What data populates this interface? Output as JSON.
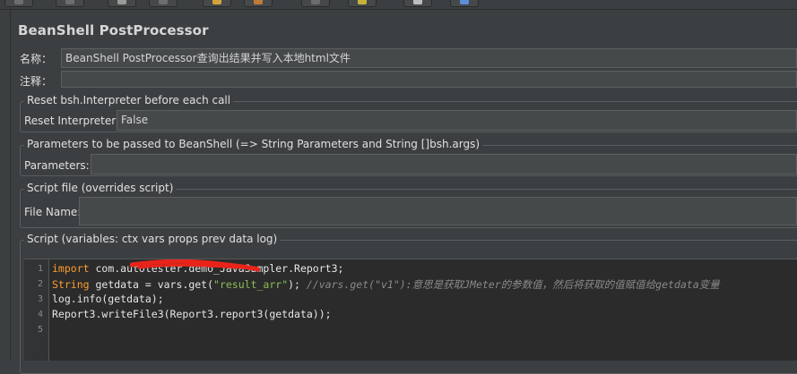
{
  "panel": {
    "title": "BeanShell PostProcessor"
  },
  "name_field": {
    "label": "名称：",
    "value": "BeanShell PostProcessor查询出结果并写入本地html文件"
  },
  "comment_field": {
    "label": "注释：",
    "value": ""
  },
  "reset_group": {
    "title": "Reset bsh.Interpreter before each call",
    "label": "Reset Interpreter:",
    "value": "False"
  },
  "params_group": {
    "title": "Parameters to be passed to BeanShell (=> String Parameters and String []bsh.args)",
    "label": "Parameters:",
    "value": ""
  },
  "script_file_group": {
    "title": "Script file (overrides script)",
    "label": "File Name:",
    "value": ""
  },
  "script_group": {
    "title": "Script (variables: ctx vars props prev data log)",
    "line_numbers": [
      "1",
      "2",
      "3",
      "4",
      "5"
    ],
    "lines": {
      "l1_kw": "import",
      "l1_rest": " com.autotester.demo_JavaSampler.Report3;",
      "l2_kw": "String",
      "l2_a": " getdata = vars.get(",
      "l2_str": "\"result_arr\"",
      "l2_b": "); ",
      "l2_cmt": "//vars.get(\"v1\"):意思是获取JMeter的参数值，然后将获取的值赋值给getdata变量",
      "l3": "log.info(getdata);",
      "l4": "Report3.writeFile3(Report3.report3(getdata));"
    }
  },
  "colors": {
    "background": "#3c3f41",
    "keyword": "#ff9d2f",
    "string": "#8cbf5a",
    "comment": "#8a8a8a",
    "redaction": "#e8241a"
  }
}
